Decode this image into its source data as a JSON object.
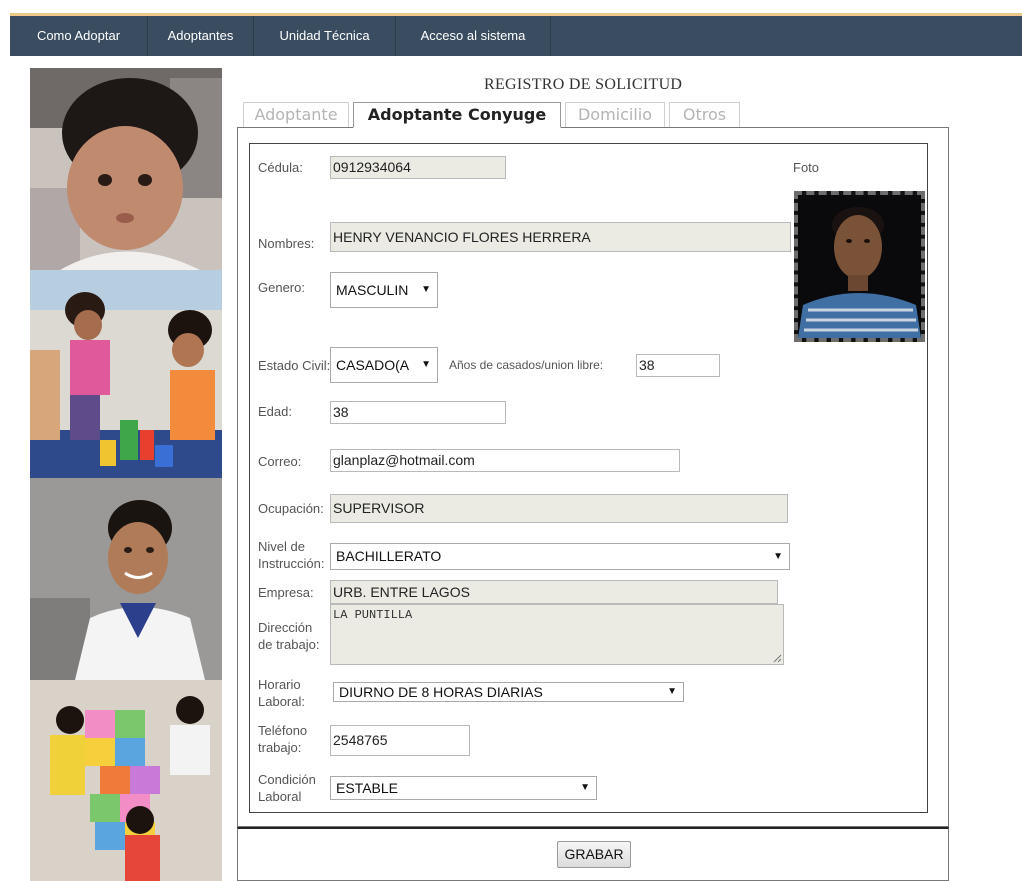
{
  "nav": {
    "items": [
      {
        "label": "Como Adoptar"
      },
      {
        "label": "Adoptantes"
      },
      {
        "label": "Unidad Técnica"
      },
      {
        "label": "Acceso al sistema"
      }
    ]
  },
  "form": {
    "title": "REGISTRO DE SOLICITUD",
    "tabs": [
      {
        "label": "Adoptante",
        "active": false
      },
      {
        "label": "Adoptante Conyuge",
        "active": true
      },
      {
        "label": "Domicilio",
        "active": false
      },
      {
        "label": "Otros",
        "active": false
      }
    ],
    "foto_label": "Foto",
    "fields": {
      "cedula": {
        "label": "Cédula:",
        "value": "0912934064"
      },
      "nombres": {
        "label": "Nombres:",
        "value": "HENRY VENANCIO FLORES HERRERA"
      },
      "genero": {
        "label": "Genero:",
        "value": "MASCULIN"
      },
      "estado_civil": {
        "label": "Estado Civil:",
        "value": "CASADO(A"
      },
      "anios_casados": {
        "label": "Años de casados/union libre:",
        "value": "38"
      },
      "edad": {
        "label": "Edad:",
        "value": "38"
      },
      "correo": {
        "label": "Correo:",
        "value": "glanplaz@hotmail.com"
      },
      "ocupacion": {
        "label": "Ocupación:",
        "value": "SUPERVISOR"
      },
      "nivel_instruccion": {
        "label_1": "Nivel de",
        "label_2": "Instrucción:",
        "value": "BACHILLERATO"
      },
      "empresa": {
        "label": "Empresa:",
        "value": "URB. ENTRE LAGOS"
      },
      "direccion_trabajo": {
        "label_1": "Dirección",
        "label_2": "de trabajo:",
        "value": "LA PUNTILLA"
      },
      "horario_laboral": {
        "label_1": "Horario",
        "label_2": "Laboral:",
        "value": "DIURNO DE 8 HORAS DIARIAS"
      },
      "telefono_trabajo": {
        "label_1": "Teléfono",
        "label_2": "trabajo:",
        "value": "2548765"
      },
      "condicion_laboral": {
        "label_1": "Condición",
        "label_2": "Laboral",
        "value": "ESTABLE"
      }
    },
    "submit_label": "GRABAR"
  },
  "colors": {
    "nav_bg": "#3a4d60",
    "nav_accent": "#ecc889",
    "readonly_bg": "#ebebe4"
  }
}
